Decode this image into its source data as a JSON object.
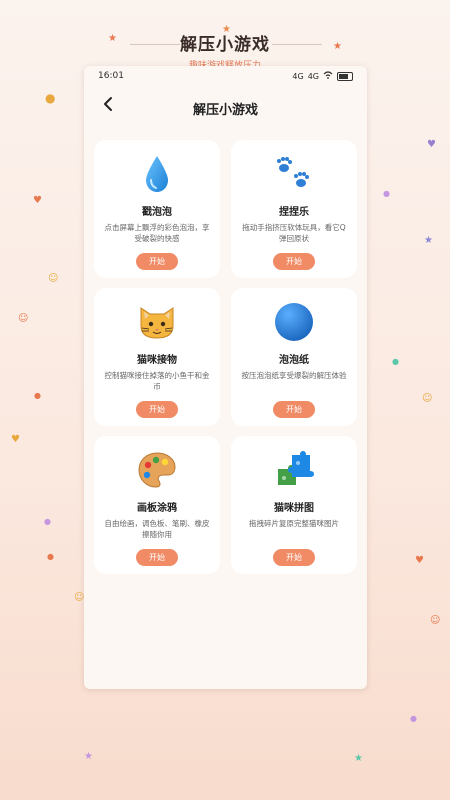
{
  "banner": {
    "title": "解压小游戏",
    "subtitle": "趣味游戏释放压力"
  },
  "status_bar": {
    "time": "16:01",
    "signal_1": "4G",
    "signal_2": "4G"
  },
  "navbar": {
    "back_icon": "chevron-left-icon",
    "title": "解压小游戏"
  },
  "games": [
    {
      "name": "戳泡泡",
      "desc": "点击屏幕上飘浮的彩色泡泡，享受破裂的快感",
      "button": "开始",
      "icon": "water-drop-icon"
    },
    {
      "name": "捏捏乐",
      "desc": "拖动手指挤压软体玩具，看它Q弹回原状",
      "button": "开始",
      "icon": "paw-prints-icon"
    },
    {
      "name": "猫咪接物",
      "desc": "控制猫咪接住掉落的小鱼干和金币",
      "button": "开始",
      "icon": "cat-face-icon"
    },
    {
      "name": "泡泡纸",
      "desc": "按压泡泡纸享受爆裂的解压体验",
      "button": "开始",
      "icon": "blue-circle-icon"
    },
    {
      "name": "画板涂鸦",
      "desc": "自由绘画，调色板、笔刷、橡皮擦随你用",
      "button": "开始",
      "icon": "palette-icon"
    },
    {
      "name": "猫咪拼图",
      "desc": "拖拽碎片复原完整猫咪图片",
      "button": "开始",
      "icon": "puzzle-icon"
    }
  ],
  "colors": {
    "accent": "#f08b65",
    "card": "#ffffff",
    "page": "#fdf7f3",
    "drop": "#2a9ae8",
    "paw": "#2f7fd6",
    "bubble": "#2a7fdb"
  }
}
